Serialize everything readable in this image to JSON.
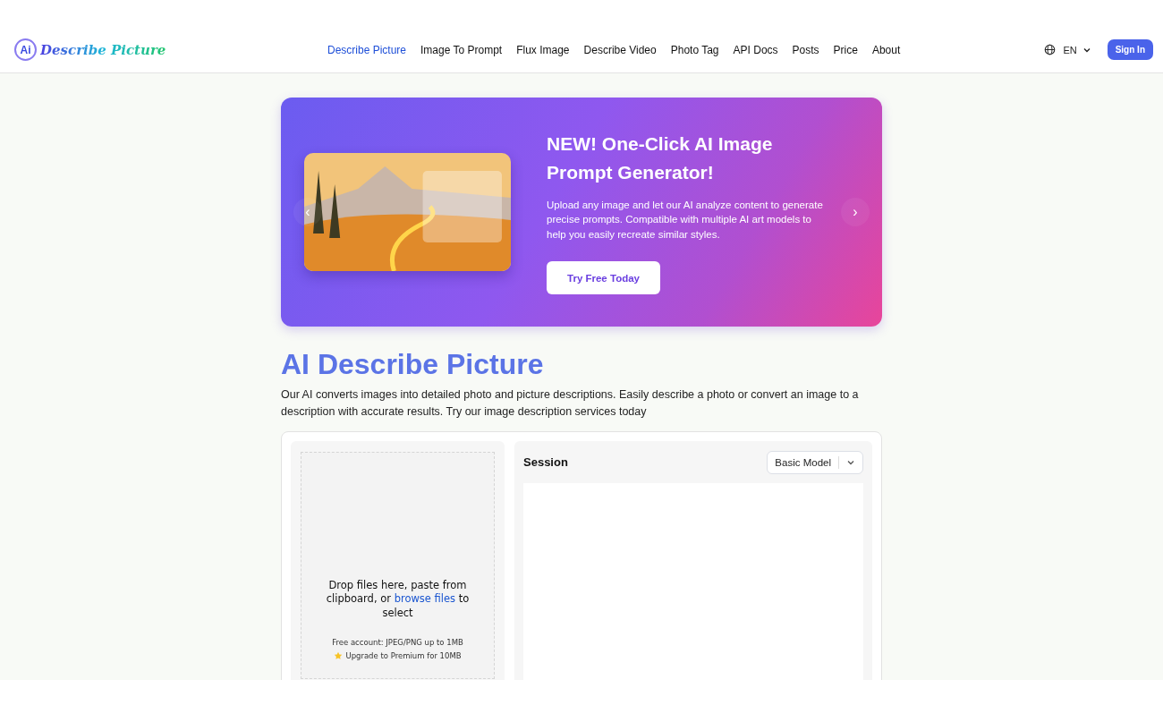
{
  "header": {
    "logo_mark": "Ai",
    "logo_text": "Describe Picture",
    "nav": [
      {
        "label": "Describe Picture",
        "selected": true
      },
      {
        "label": "Image To Prompt",
        "selected": false
      },
      {
        "label": "Flux Image",
        "selected": false
      },
      {
        "label": "Describe Video",
        "selected": false
      },
      {
        "label": "Photo Tag",
        "selected": false
      },
      {
        "label": "API Docs",
        "selected": false
      },
      {
        "label": "Posts",
        "selected": false
      },
      {
        "label": "Price",
        "selected": false
      },
      {
        "label": "About",
        "selected": false
      }
    ],
    "language": "EN",
    "sign_in": "Sign In"
  },
  "banner": {
    "title": "NEW! One-Click AI Image Prompt Generator!",
    "description": "Upload any image and let our AI analyze content to generate precise prompts. Compatible with multiple AI art models to help you easily recreate similar styles.",
    "button": "Try Free Today",
    "prev": "‹",
    "next": "›"
  },
  "heading": "AI Describe Picture",
  "intro": "Our AI converts images into detailed photo and picture descriptions. Easily describe a photo or convert an image to a description with accurate results. Try our image description services today",
  "upload": {
    "text_before": "Drop files here, paste from clipboard, or",
    "link": "browse files",
    "text_after": "to select",
    "limit": "Free account: JPEG/PNG up to 1MB",
    "upgrade": "Upgrade to Premium for 10MB"
  },
  "session": {
    "title": "Session",
    "model": "Basic Model"
  }
}
